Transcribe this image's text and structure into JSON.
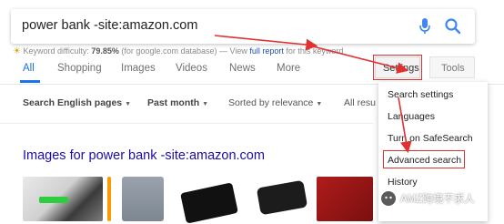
{
  "search": {
    "query": "power bank -site:amazon.com"
  },
  "keyword_bar": {
    "label": "Keyword difficulty:",
    "value": "79.85%",
    "source": "(for google.com database)",
    "dash": " — View ",
    "link": "full report",
    "tail": " for this keyword"
  },
  "tabs": [
    {
      "label": "All",
      "active": true
    },
    {
      "label": "Shopping"
    },
    {
      "label": "Images"
    },
    {
      "label": "Videos"
    },
    {
      "label": "News"
    },
    {
      "label": "More"
    }
  ],
  "buttons": {
    "settings": "Settings",
    "tools": "Tools"
  },
  "filters": {
    "language": "Search English pages",
    "time": "Past month",
    "sort": "Sorted by relevance",
    "all": "All resu"
  },
  "images_section": {
    "title": "Images for power bank -site:amazon.com"
  },
  "settings_menu": {
    "items": [
      "Search settings",
      "Languages",
      "Turn on SafeSearch",
      "Advanced search",
      "History"
    ],
    "highlighted": "Advanced search"
  },
  "watermark": {
    "text": "AMZ跨境不求人"
  },
  "colors": {
    "accent_blue": "#1a73e8",
    "link_blue": "#1a0dab",
    "annotation_red": "#e03030"
  }
}
